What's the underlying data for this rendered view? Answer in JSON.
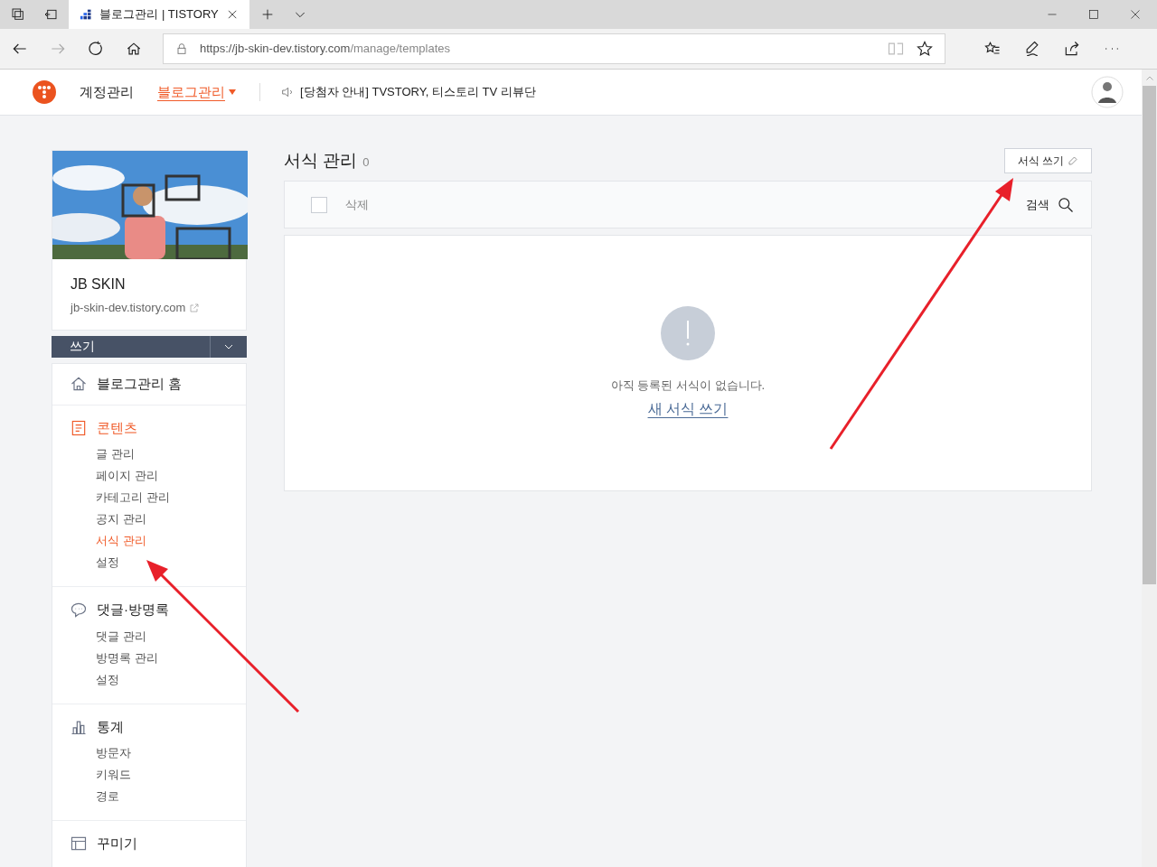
{
  "browser": {
    "tab_title": "블로그관리 | TISTORY",
    "url_host": "https://jb-skin-dev.tistory.com",
    "url_path": "/manage/templates"
  },
  "header": {
    "nav": [
      {
        "label": "계정관리",
        "selected": false
      },
      {
        "label": "블로그관리",
        "selected": true
      }
    ],
    "notice": "[당첨자 안내] TVSTORY, 티스토리 TV 리뷰단"
  },
  "blog": {
    "name": "JB SKIN",
    "address": "jb-skin-dev.tistory.com"
  },
  "write_button": "쓰기",
  "sidebar": {
    "home": "블로그관리 홈",
    "sections": [
      {
        "kind": "document",
        "title": "콘텐츠",
        "selected": true,
        "children": [
          {
            "label": "글 관리",
            "selected": false
          },
          {
            "label": "페이지 관리",
            "selected": false
          },
          {
            "label": "카테고리 관리",
            "selected": false
          },
          {
            "label": "공지 관리",
            "selected": false
          },
          {
            "label": "서식 관리",
            "selected": true
          },
          {
            "label": "설정",
            "selected": false
          }
        ]
      },
      {
        "kind": "comment",
        "title": "댓글·방명록",
        "selected": false,
        "children": [
          {
            "label": "댓글 관리",
            "selected": false
          },
          {
            "label": "방명록 관리",
            "selected": false
          },
          {
            "label": "설정",
            "selected": false
          }
        ]
      },
      {
        "kind": "chart",
        "title": "통계",
        "selected": false,
        "children": [
          {
            "label": "방문자",
            "selected": false
          },
          {
            "label": "키워드",
            "selected": false
          },
          {
            "label": "경로",
            "selected": false
          }
        ]
      },
      {
        "kind": "layout",
        "title": "꾸미기",
        "selected": false
      }
    ]
  },
  "main": {
    "title": "서식 관리",
    "count": "0",
    "new_button": "서식 쓰기",
    "toolbar": {
      "select_all_checked": false,
      "delete": "삭제",
      "search": "검색"
    },
    "empty": {
      "message": "아직 등록된 서식이 없습니다.",
      "link": "새 서식 쓰기"
    }
  }
}
